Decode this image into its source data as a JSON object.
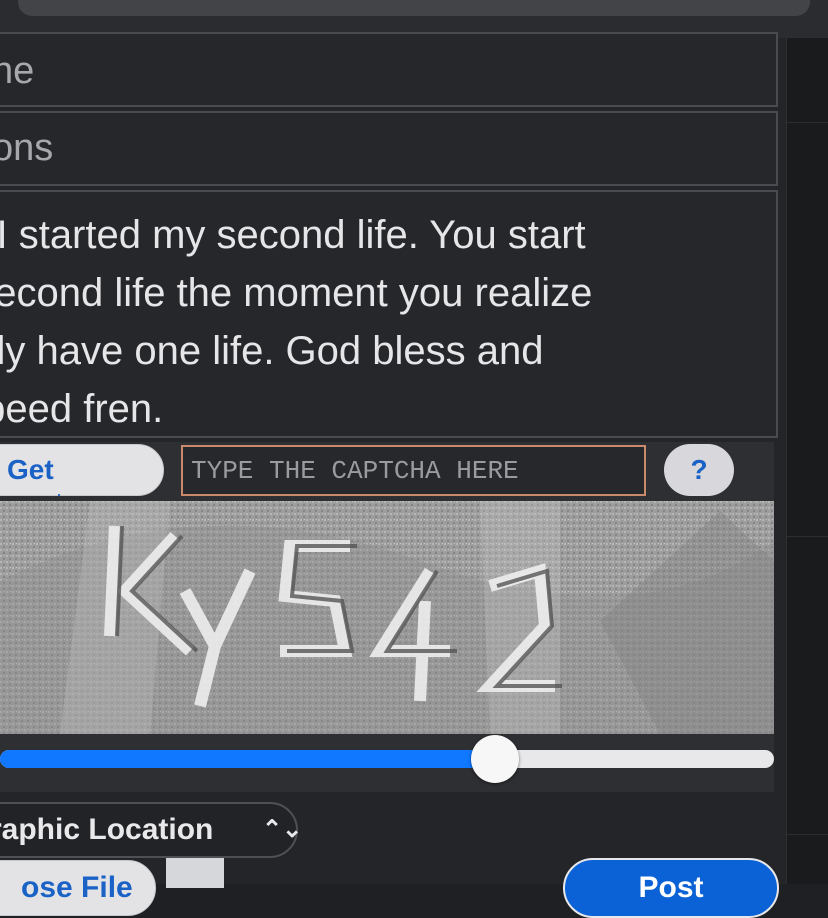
{
  "form": {
    "name_field_text": "ne",
    "options_field_text": "ons",
    "comment_lines": [
      "n. I started my second life. You start",
      "/ second life the moment you realize",
      "only have one life. God bless and",
      " speed fren."
    ],
    "get_button_label": "Get",
    "captcha_placeholder": "TYPE THE CAPTCHA HERE",
    "help_button_label": "?",
    "slider_value_fraction": 0.64,
    "geo_select_label": "raphic Location",
    "geo_select_icon": "up-down-chevron-icon",
    "choose_file_label": "ose File",
    "post_button_label": "Post"
  },
  "colors": {
    "accent_blue": "#1078ff",
    "captcha_border": "#c98a6b",
    "button_text_blue": "#1a62c6"
  }
}
